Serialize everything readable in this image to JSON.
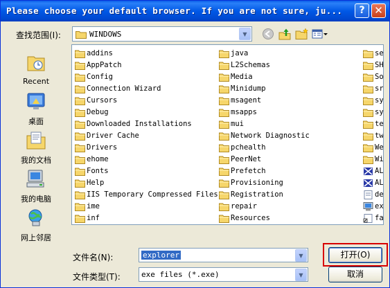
{
  "window": {
    "title": "Please choose your default browser. If you are not sure, ju...",
    "help_glyph": "?",
    "close_glyph": "✕"
  },
  "lookin": {
    "label": "查找范围(I):",
    "value": "WINDOWS"
  },
  "places": [
    {
      "label": "Recent",
      "icon": "recent-folder-icon"
    },
    {
      "label": "桌面",
      "icon": "desktop-icon"
    },
    {
      "label": "我的文档",
      "icon": "my-documents-icon"
    },
    {
      "label": "我的电脑",
      "icon": "my-computer-icon"
    },
    {
      "label": "网上邻居",
      "icon": "network-places-icon"
    }
  ],
  "files": {
    "col1": [
      "addins",
      "AppPatch",
      "Config",
      "Connection Wizard",
      "Cursors",
      "Debug",
      "Downloaded Installations",
      "Driver Cache",
      "Drivers",
      "ehome",
      "Fonts",
      "Help",
      "IIS Temporary Compressed Files",
      "ime",
      "inf"
    ],
    "col2": [
      "java",
      "L2Schemas",
      "Media",
      "Minidump",
      "msagent",
      "msapps",
      "mui",
      "Network Diagnostic",
      "pchealth",
      "PeerNet",
      "Prefetch",
      "Provisioning",
      "Registration",
      "repair",
      "Resources"
    ],
    "col3": [
      "se",
      "SH",
      "So",
      "sr",
      "sy",
      "sy",
      "te",
      "tw",
      "We",
      "Wi",
      "AL",
      "AL",
      "de",
      "ex",
      "fa"
    ],
    "col3_icons": [
      "folder",
      "folder",
      "folder",
      "folder",
      "folder",
      "folder",
      "folder",
      "folder",
      "folder",
      "folder",
      "special",
      "special",
      "file",
      "exe",
      "shortcut"
    ]
  },
  "filename": {
    "label": "文件名(N):",
    "value": "explorer"
  },
  "filetype": {
    "label": "文件类型(T):",
    "value": "exe files (*.exe)"
  },
  "buttons": {
    "open": "打开(O)",
    "cancel": "取消"
  }
}
